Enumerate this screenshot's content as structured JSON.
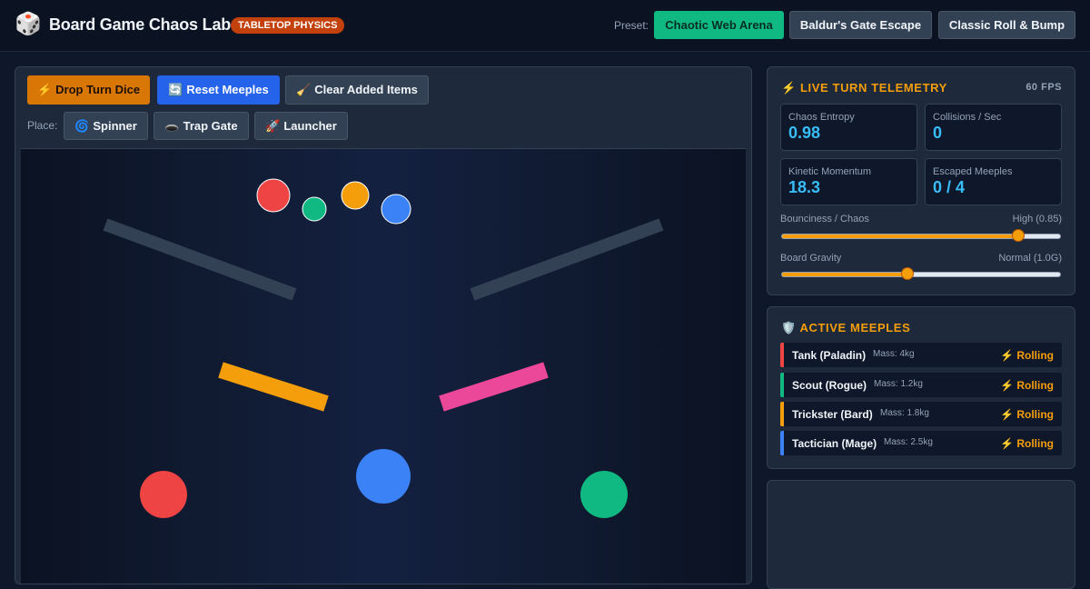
{
  "app": {
    "icon": "die-icon",
    "title": "Board Game Chaos Lab",
    "badge": "TABLETOP PHYSICS"
  },
  "presets": {
    "label": "Preset:",
    "items": [
      {
        "label": "Chaotic Web Arena",
        "active": true
      },
      {
        "label": "Baldur's Gate Escape",
        "active": false
      },
      {
        "label": "Classic Roll & Bump",
        "active": false
      }
    ]
  },
  "toolbar": {
    "drop_dice": {
      "icon": "⚡",
      "label": "Drop Turn Dice"
    },
    "reset_meeples": {
      "icon": "🔄",
      "label": "Reset Meeples"
    },
    "clear_items": {
      "icon": "🧹",
      "label": "Clear Added Items"
    },
    "place_label": "Place:",
    "spinner": {
      "icon": "🌀",
      "label": "Spinner"
    },
    "trap_gate": {
      "icon": "🕳️",
      "label": "Trap Gate"
    },
    "launcher": {
      "icon": "🚀",
      "label": "Launcher"
    }
  },
  "board": {
    "colors": {
      "red": "#ef4444",
      "green": "#10b981",
      "orange": "#f59e0b",
      "blue": "#3b82f6",
      "pink": "#ec4899",
      "ramp": "#334155"
    }
  },
  "telemetry": {
    "title": "LIVE TURN TELEMETRY",
    "icon": "⚡",
    "fps": "60 FPS",
    "stats": [
      {
        "label": "Chaos Entropy",
        "value": "0.98"
      },
      {
        "label": "Collisions / Sec",
        "value": "0"
      },
      {
        "label": "Kinetic Momentum",
        "value": "18.3"
      },
      {
        "label": "Escaped Meeples",
        "value": "0 / 4"
      }
    ],
    "sliders": [
      {
        "label": "Bounciness / Chaos",
        "value_text": "High (0.85)",
        "value": 0.85
      },
      {
        "label": "Board Gravity",
        "value_text": "Normal (1.0G)",
        "value": 0.45
      }
    ]
  },
  "meeples": {
    "title": "ACTIVE MEEPLES",
    "icon": "🛡️",
    "items": [
      {
        "name": "Tank (Paladin)",
        "mass": "Mass: 4kg",
        "status": "Rolling",
        "status_icon": "⚡",
        "color": "#ef4444"
      },
      {
        "name": "Scout (Rogue)",
        "mass": "Mass: 1.2kg",
        "status": "Rolling",
        "status_icon": "⚡",
        "color": "#10b981"
      },
      {
        "name": "Trickster (Bard)",
        "mass": "Mass: 1.8kg",
        "status": "Rolling",
        "status_icon": "⚡",
        "color": "#f59e0b"
      },
      {
        "name": "Tactician (Mage)",
        "mass": "Mass: 2.5kg",
        "status": "Rolling",
        "status_icon": "⚡",
        "color": "#3b82f6"
      }
    ]
  }
}
